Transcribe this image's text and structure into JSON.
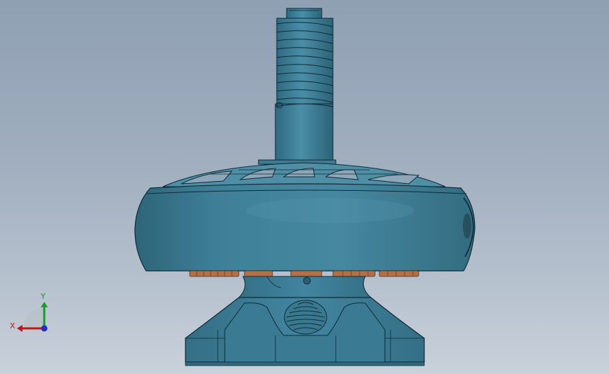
{
  "viewport": {
    "background_top": "#8fa0b3",
    "background_bottom": "#c9d1da"
  },
  "model": {
    "body_color": "#3d7c93",
    "body_dark": "#2a5e72",
    "edge_color": "#0f2a36",
    "copper_color": "#b0704a"
  },
  "triad": {
    "x_label": "X",
    "y_label": "Y",
    "x_color": "#c01818",
    "y_color": "#1a9a2a",
    "z_color": "#2030c0"
  }
}
